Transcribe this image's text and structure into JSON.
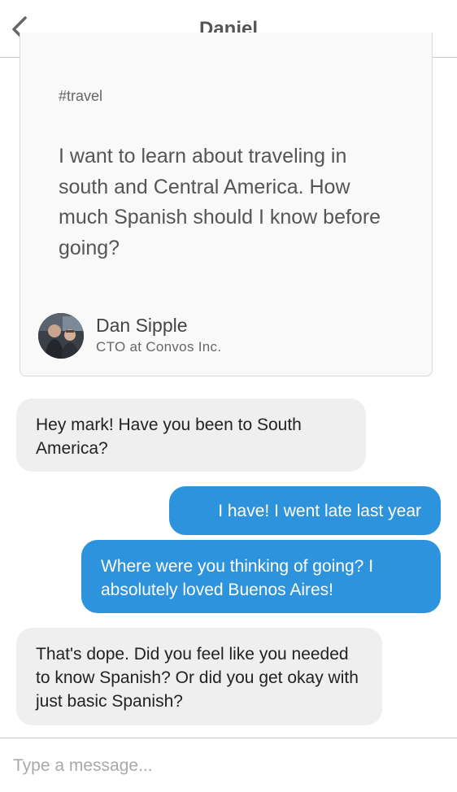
{
  "header": {
    "title": "Daniel",
    "back_icon": "chevron-left-icon"
  },
  "prompt_card": {
    "tag": "#travel",
    "question": "I want to learn about traveling in south and Central America. How much Spanish should I know before going?",
    "author": {
      "name": "Dan Sipple",
      "title": "CTO at Convos Inc."
    }
  },
  "messages": [
    {
      "direction": "incoming",
      "text": "Hey mark! Have you been to South America?"
    },
    {
      "direction": "outgoing",
      "text": "I have! I went late last year"
    },
    {
      "direction": "outgoing",
      "text": "Where were you thinking of going? I absolutely loved Buenos Aires!"
    },
    {
      "direction": "incoming",
      "text": "That's dope. Did you feel like you needed to know Spanish? Or did you get okay with just basic Spanish?"
    }
  ],
  "composer": {
    "placeholder": "Type a message...",
    "value": ""
  },
  "colors": {
    "outgoing_bubble": "#2e93dd",
    "incoming_bubble": "#efefef",
    "card_background": "#f9f9f9"
  }
}
